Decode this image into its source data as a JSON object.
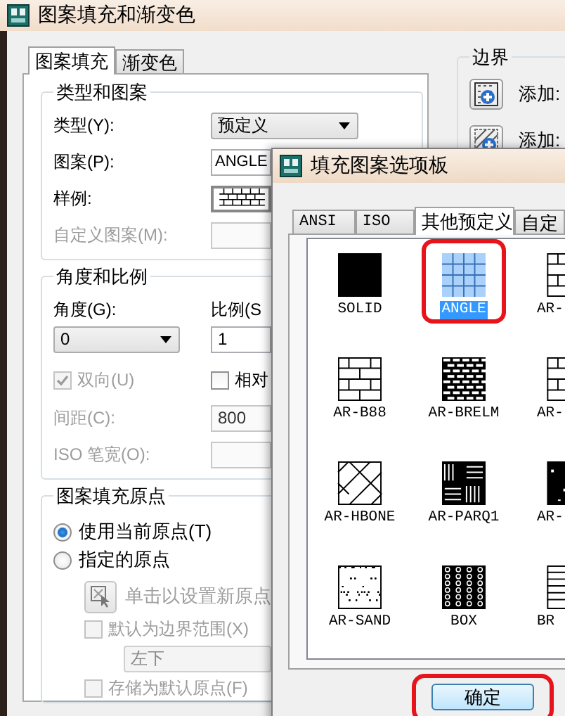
{
  "hatch_dialog": {
    "title": "图案填充和渐变色",
    "tabs": [
      {
        "label": "图案填充",
        "selected": true
      },
      {
        "label": "渐变色",
        "selected": false
      }
    ],
    "type_and_pattern": {
      "title": "类型和图案",
      "type": {
        "label": "类型(Y):",
        "value": "预定义"
      },
      "pattern": {
        "label": "图案(P):",
        "value": "ANGLE"
      },
      "sample_label": "样例:",
      "custom_pattern": {
        "label": "自定义图案(M):",
        "disabled": true
      }
    },
    "angle_and_scale": {
      "title": "角度和比例",
      "angle": {
        "label": "角度(G):",
        "value": "0"
      },
      "scale": {
        "label": "比例(S",
        "value": "1"
      },
      "double": {
        "label": "双向(U)",
        "checked": true,
        "disabled": true
      },
      "relative": {
        "label": "相对",
        "checked": false,
        "disabled": false
      },
      "spacing": {
        "label": "间距(C):",
        "value": "800",
        "disabled": true
      },
      "iso_pen_width": {
        "label": "ISO 笔宽(O):",
        "disabled": true
      }
    },
    "hatch_origin": {
      "title": "图案填充原点",
      "options": [
        {
          "label": "使用当前原点(T)",
          "selected": true
        },
        {
          "label": "指定的原点",
          "selected": false
        }
      ],
      "set_origin": {
        "label": "单击以设置新原点",
        "disabled": true
      },
      "default_to_extents": {
        "label": "默认为边界范围(X)",
        "checked": false,
        "disabled": true
      },
      "position": {
        "value": "左下",
        "disabled": true
      },
      "store_as_default": {
        "label": "存储为默认原点(F)",
        "checked": false,
        "disabled": true
      }
    },
    "boundaries": {
      "title": "边界",
      "buttons": [
        {
          "label": "添加:"
        },
        {
          "label": "添加:"
        }
      ]
    }
  },
  "pattern_palette": {
    "title": "填充图案选项板",
    "tabs": [
      {
        "label": "ANSI",
        "selected": false
      },
      {
        "label": "ISO",
        "selected": false
      },
      {
        "label": "其他预定义",
        "selected": true
      },
      {
        "label": "自定",
        "selected": false
      }
    ],
    "patterns": [
      {
        "name": "SOLID",
        "kind": "solid",
        "selected": false,
        "highlighted": false
      },
      {
        "name": "ANGLE",
        "kind": "grid",
        "selected": true,
        "highlighted": true
      },
      {
        "name": "AR-",
        "kind": "brick",
        "selected": false,
        "highlighted": false
      },
      {
        "name": "AR-B88",
        "kind": "brick",
        "selected": false,
        "highlighted": false
      },
      {
        "name": "AR-BRELM",
        "kind": "brick-dense",
        "selected": false,
        "highlighted": false
      },
      {
        "name": "AR-",
        "kind": "brick",
        "selected": false,
        "highlighted": false
      },
      {
        "name": "AR-HBONE",
        "kind": "herringbone",
        "selected": false,
        "highlighted": false
      },
      {
        "name": "AR-PARQ1",
        "kind": "parquet",
        "selected": false,
        "highlighted": false
      },
      {
        "name": "AR-",
        "kind": "speckle",
        "selected": false,
        "highlighted": false
      },
      {
        "name": "AR-SAND",
        "kind": "sand",
        "selected": false,
        "highlighted": false
      },
      {
        "name": "BOX",
        "kind": "box",
        "selected": false,
        "highlighted": false
      },
      {
        "name": "BR",
        "kind": "lines",
        "selected": false,
        "highlighted": false
      }
    ],
    "ok_button": {
      "label": "确定",
      "highlighted": true
    }
  }
}
